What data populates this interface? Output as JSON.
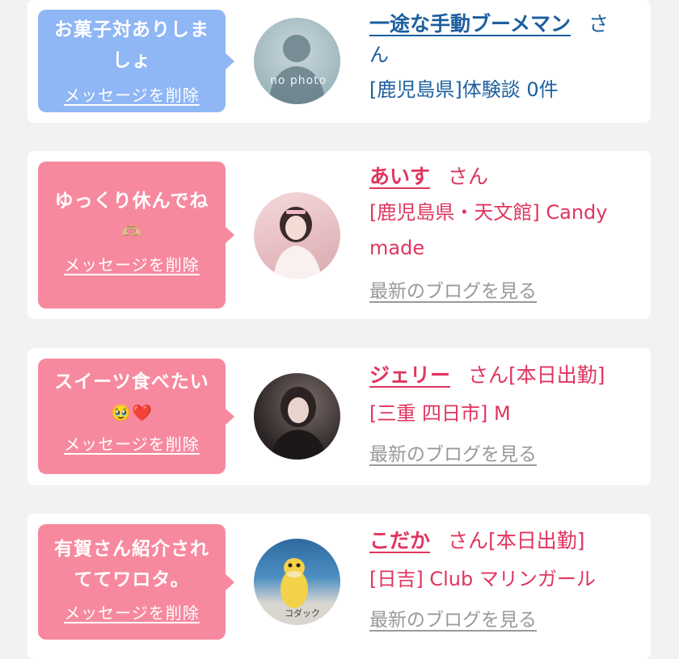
{
  "colors": {
    "bubble_blue": "#8fb6f5",
    "bubble_pink": "#f7899f",
    "name_blue": "#1c5f9f",
    "name_pink": "#e0355f",
    "link_gray": "#999999"
  },
  "cards": [
    {
      "message_lines": [
        "お菓子対ありしま",
        "しょ"
      ],
      "delete_label": "メッセージを削除",
      "avatar": "no-photo",
      "avatar_text": "no photo",
      "name": "一途な手動ブーメマン",
      "honorific": "さ",
      "honorific_cont": "ん",
      "detail": "[鹿児島県]体験談 0件"
    },
    {
      "message_lines": [
        "ゆっくり休んでね",
        "🫶🏼"
      ],
      "delete_label": "メッセージを削除",
      "avatar": "photo-girl-white",
      "name": "あいす",
      "honorific": "さん",
      "detail_lines": [
        "[鹿児島県・天文館] Candy",
        "made"
      ],
      "blog_label": "最新のブログを見る"
    },
    {
      "message_lines": [
        "スイーツ食べたい",
        "🥹❤️"
      ],
      "delete_label": "メッセージを削除",
      "avatar": "photo-girl-dark",
      "name": "ジェリー",
      "honorific": "さん[本日出勤]",
      "detail": "[三重 四日市] M",
      "blog_label": "最新のブログを見る"
    },
    {
      "message_lines": [
        "有賀さん紹介され",
        "ててワロタ。"
      ],
      "delete_label": "メッセージを削除",
      "avatar": "photo-psyduck",
      "avatar_text": "コダック",
      "name": "こだか",
      "honorific": "さん[本日出勤]",
      "detail": "[日吉] Club マリンガール",
      "blog_label": "最新のブログを見る"
    }
  ]
}
